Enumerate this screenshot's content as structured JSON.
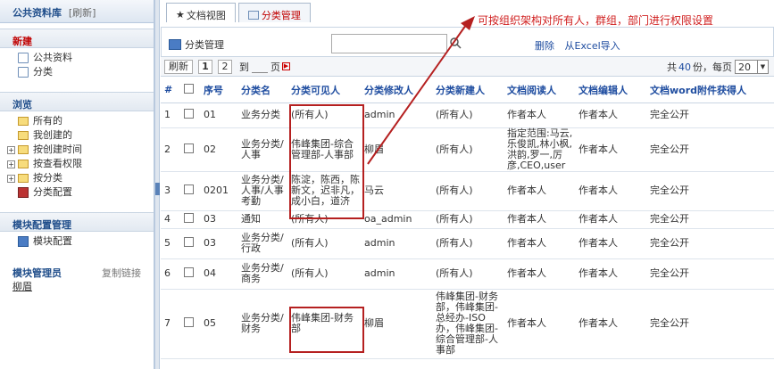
{
  "sidebar": {
    "title": "公共资料库",
    "refresh": "[刷新]",
    "new_section": "新建",
    "new_items": [
      "公共资料",
      "分类"
    ],
    "browse_section": "浏览",
    "browse_items": [
      "所有的",
      "我创建的",
      "按创建时间",
      "按查看权限",
      "按分类",
      "分类配置"
    ],
    "module_config_section": "模块配置管理",
    "module_config_item": "模块配置",
    "admin_section": "模块管理员",
    "copy_link": "复制链接",
    "admin_user": "柳眉"
  },
  "tabs": [
    {
      "label": "文档视图",
      "icon": "star-icon"
    },
    {
      "label": "分类管理",
      "icon": "table-icon"
    }
  ],
  "toolbar": {
    "title": "分类管理",
    "search_placeholder": "",
    "delete_label": "删除",
    "import_label": "从Excel导入"
  },
  "pager": {
    "refresh": "刷新",
    "pages": [
      "1",
      "2"
    ],
    "goto_prefix": "到",
    "goto_suffix": "页",
    "total_prefix": "共",
    "total_count": "40",
    "total_suffix": "份，每页",
    "page_size": "20"
  },
  "table": {
    "headers": [
      "#",
      "",
      "序号",
      "分类名",
      "分类可见人",
      "分类修改人",
      "分类新建人",
      "文档阅读人",
      "文档编辑人",
      "文档word附件获得人"
    ],
    "rows": [
      {
        "idx": "1",
        "seq": "01",
        "name": "业务分类",
        "visible": "(所有人)",
        "modifier": "admin",
        "creator": "(所有人)",
        "reader": "作者本人",
        "editor": "作者本人",
        "word": "完全公开"
      },
      {
        "idx": "2",
        "seq": "02",
        "name": "业务分类/人事",
        "visible": "伟峰集团-综合管理部-人事部",
        "modifier": "柳眉",
        "creator": "(所有人)",
        "reader": "指定范围:马云,乐俊凯,林小枫,洪韵,罗一,厉彦,CEO,user",
        "editor": "作者本人",
        "word": "完全公开"
      },
      {
        "idx": "3",
        "seq": "0201",
        "name": "业务分类/人事/人事考勤",
        "visible": "陈淀，陈西，陈新文，迟非凡，成小白，道济",
        "modifier": "马云",
        "creator": "(所有人)",
        "reader": "作者本人",
        "editor": "作者本人",
        "word": "完全公开"
      },
      {
        "idx": "4",
        "seq": "03",
        "name": "通知",
        "visible": "(所有人)",
        "modifier": "oa_admin",
        "creator": "(所有人)",
        "reader": "作者本人",
        "editor": "作者本人",
        "word": "完全公开"
      },
      {
        "idx": "5",
        "seq": "03",
        "name": "业务分类/行政",
        "visible": "(所有人)",
        "modifier": "admin",
        "creator": "(所有人)",
        "reader": "作者本人",
        "editor": "作者本人",
        "word": "完全公开"
      },
      {
        "idx": "6",
        "seq": "04",
        "name": "业务分类/商务",
        "visible": "(所有人)",
        "modifier": "admin",
        "creator": "(所有人)",
        "reader": "作者本人",
        "editor": "作者本人",
        "word": "完全公开"
      },
      {
        "idx": "7",
        "seq": "05",
        "name": "业务分类/财务",
        "visible": "伟峰集团-财务部",
        "modifier": "柳眉",
        "creator": "伟峰集团-财务部，伟峰集团-总经办-ISO办，伟峰集团-综合管理部-人事部",
        "reader": "作者本人",
        "editor": "作者本人",
        "word": "完全公开"
      }
    ]
  },
  "annotation": "可按组织架构对所有人，群组，部门进行权限设置",
  "colors": {
    "annotation": "#d02020",
    "link": "#1f4da0",
    "header_blue": "#1f4d8a"
  }
}
